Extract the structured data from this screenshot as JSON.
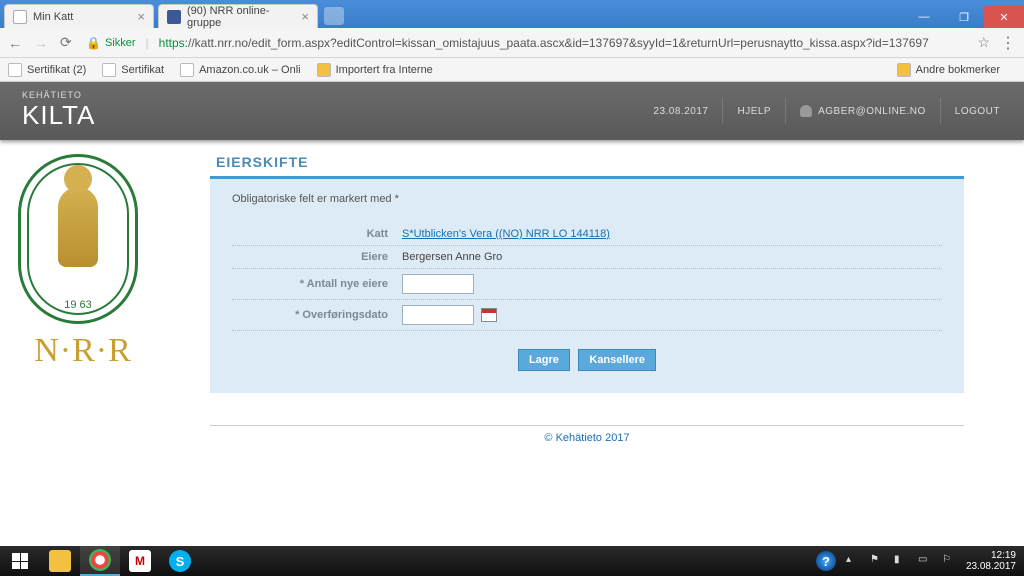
{
  "browser": {
    "tabs": [
      {
        "title": "Min Katt"
      },
      {
        "title": "(90) NRR online-gruppe"
      }
    ],
    "secure_label": "Sikker",
    "url_https": "https",
    "url_rest": "://katt.nrr.no/edit_form.aspx?editControl=kissan_omistajuus_paata.ascx&id=137697&syyId=1&returnUrl=perusnaytto_kissa.aspx?id=137697",
    "bookmarks": [
      "Sertifikat (2)",
      "Sertifikat",
      "Amazon.co.uk – Onli",
      "Importert fra Interne"
    ],
    "more_bookmarks": "Andre bokmerker"
  },
  "header": {
    "vendor": "KEHÄTIETO",
    "app": "KILTA",
    "date": "23.08.2017",
    "help": "HJELP",
    "user": "AGBER@ONLINE.NO",
    "logout": "LOGOUT"
  },
  "logo": {
    "year": "19   63",
    "nrr": "N·R·R"
  },
  "page": {
    "title": "EIERSKIFTE",
    "required_note": "Obligatoriske felt er markert med *",
    "rows": {
      "cat_label": "Katt",
      "cat_value": "S*Utblicken's Vera ((NO) NRR LO 144118)",
      "owner_label": "Eiere",
      "owner_value": "Bergersen Anne Gro",
      "count_label": "* Antall nye eiere",
      "date_label": "* Overføringsdato"
    },
    "buttons": {
      "save": "Lagre",
      "cancel": "Kansellere"
    },
    "footer": "© Kehätieto 2017"
  },
  "taskbar": {
    "clock": "12:19",
    "date": "23.08.2017"
  }
}
